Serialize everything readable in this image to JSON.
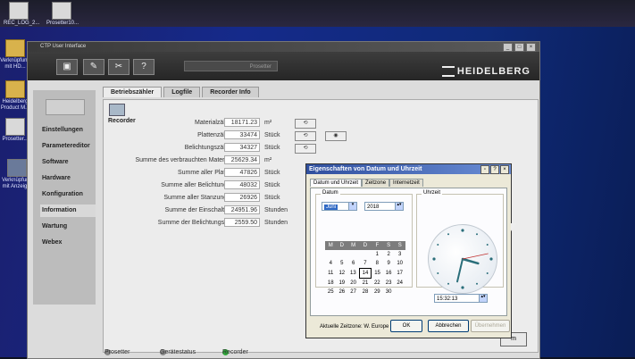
{
  "desktop": {
    "icons": [
      {
        "label": "REC_LOG_2..."
      },
      {
        "label": "Prosetter10..."
      },
      {
        "label": "Verknüpfung mit HD..."
      },
      {
        "label": "Heidelberg Product M..."
      },
      {
        "label": "Prosetter..."
      },
      {
        "label": "Verknüpfung mit Anzeig..."
      }
    ]
  },
  "app": {
    "title": "CTP User Interface",
    "toolbar": {
      "buttons": [
        {
          "icon": "device-icon",
          "glyph": "▣"
        },
        {
          "icon": "wrench-icon",
          "glyph": "✎"
        },
        {
          "icon": "tools-icon",
          "glyph": "✂"
        },
        {
          "icon": "help-icon",
          "glyph": "?"
        }
      ],
      "device_name": "Prosetter"
    },
    "brand": "HEIDELBERG",
    "sidebar": {
      "items": [
        {
          "label": "Einstellungen"
        },
        {
          "label": "Parametereditor"
        },
        {
          "label": "Software"
        },
        {
          "label": "Hardware"
        },
        {
          "label": "Konfiguration"
        },
        {
          "label": "Information",
          "active": true
        },
        {
          "label": "Wartung"
        },
        {
          "label": "Webex"
        }
      ]
    },
    "tabs": [
      {
        "label": "Betriebszähler",
        "active": true
      },
      {
        "label": "Logfile"
      },
      {
        "label": "Recorder Info"
      }
    ],
    "section_label": "Recorder",
    "counters": [
      {
        "label": "Materialzähler",
        "value": "18171.23",
        "unit": "m²"
      },
      {
        "label": "Plattenzähler",
        "value": "33474",
        "unit": "Stück"
      },
      {
        "label": "Belichtungszähler",
        "value": "34327",
        "unit": "Stück"
      },
      {
        "label": "Summe des verbrauchten Materials",
        "value": "25629.34",
        "unit": "m²"
      },
      {
        "label": "Summe aller Platten",
        "value": "47826",
        "unit": "Stück"
      },
      {
        "label": "Summe aller Belichtungen",
        "value": "48032",
        "unit": "Stück"
      },
      {
        "label": "Summe aller Stanzungen",
        "value": "26926",
        "unit": "Stück"
      },
      {
        "label": "Summe der Einschaltzeit",
        "value": "24951.96",
        "unit": "Stunden"
      },
      {
        "label": "Summe der Belichtungszeit",
        "value": "2559.50",
        "unit": "Stunden"
      }
    ],
    "ok_label": "m",
    "status": {
      "prosetter": "Prosetter",
      "device_status": "Gerätestatus",
      "recorder": "Recorder",
      "recorder_color": "#2fa83a"
    }
  },
  "dialog": {
    "title": "Eigenschaften von Datum und Uhrzeit",
    "tabs": [
      {
        "label": "Datum und Uhrzeit",
        "active": true
      },
      {
        "label": "Zeitzone"
      },
      {
        "label": "Internetzeit"
      }
    ],
    "date_group": "Datum",
    "time_group": "Uhrzeit",
    "month": "Juni",
    "year": "2018",
    "weekdays": [
      "M",
      "D",
      "M",
      "D",
      "F",
      "S",
      "S"
    ],
    "weeks": [
      [
        "",
        "",
        "",
        "",
        "1",
        "2",
        "3"
      ],
      [
        "4",
        "5",
        "6",
        "7",
        "8",
        "9",
        "10"
      ],
      [
        "11",
        "12",
        "13",
        "14",
        "15",
        "16",
        "17"
      ],
      [
        "18",
        "19",
        "20",
        "21",
        "22",
        "23",
        "24"
      ],
      [
        "25",
        "26",
        "27",
        "28",
        "29",
        "30",
        ""
      ]
    ],
    "selected_day": "14",
    "time": "15:32:13",
    "clock": {
      "hour": 15,
      "minute": 32,
      "second": 13
    },
    "timezone_text": "Aktuelle Zeitzone: W. Europe Daylight Time",
    "buttons": {
      "ok": "OK",
      "cancel": "Abbrechen",
      "apply": "Übernehmen"
    }
  }
}
